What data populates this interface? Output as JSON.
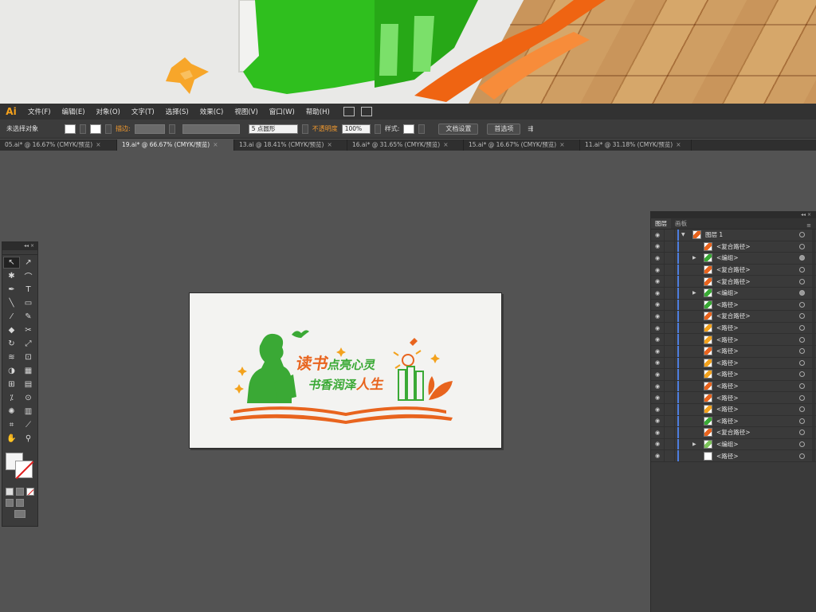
{
  "app": {
    "logo": "Ai"
  },
  "menu": [
    "文件(F)",
    "编辑(E)",
    "对象(O)",
    "文字(T)",
    "选择(S)",
    "效果(C)",
    "视图(V)",
    "窗口(W)",
    "帮助(H)"
  ],
  "control_bar": {
    "selection": "未选择对象",
    "stroke_label": "描边:",
    "brush": "5 点圆形",
    "opacity_label": "不透明度",
    "opacity_value": "100%",
    "style_label": "样式:",
    "doc_setup": "文档设置",
    "preferences": "首选项"
  },
  "tabs": [
    {
      "label": "05.ai* @ 16.67% (CMYK/预览)",
      "active": false
    },
    {
      "label": "19.ai* @ 66.67% (CMYK/预览)",
      "active": true
    },
    {
      "label": "13.ai @ 18.41% (CMYK/预览)",
      "active": false
    },
    {
      "label": "16.ai* @ 31.65% (CMYK/预览)",
      "active": false
    },
    {
      "label": "15.ai* @ 16.67% (CMYK/预览)",
      "active": false
    },
    {
      "label": "11.ai* @ 31.18% (CMYK/预览)",
      "active": false
    }
  ],
  "tab_close": "×",
  "artwork": {
    "title_big": "读书",
    "title_small": "点亮心灵",
    "subtitle": "书香润泽",
    "subtitle_end": "人生",
    "green": "#3aa935",
    "orange": "#e8641e"
  },
  "layers_panel": {
    "tab_layers": "图层",
    "tab_artboards": "画板",
    "collapse": "◂◂",
    "close": "×",
    "menu": "≡",
    "rows": [
      {
        "name": "图层 1",
        "indent": 0,
        "expand": "down",
        "thumb_color": "#e8641e",
        "target_filled": false
      },
      {
        "name": "<复合路径>",
        "indent": 1,
        "expand": "",
        "thumb_color": "#e8641e",
        "target_filled": false
      },
      {
        "name": "<编组>",
        "indent": 1,
        "expand": "right",
        "thumb_color": "#3aa935",
        "target_filled": true
      },
      {
        "name": "<复合路径>",
        "indent": 1,
        "expand": "",
        "thumb_color": "#e8641e",
        "target_filled": false
      },
      {
        "name": "<复合路径>",
        "indent": 1,
        "expand": "",
        "thumb_color": "#e8641e",
        "target_filled": false
      },
      {
        "name": "<编组>",
        "indent": 1,
        "expand": "right",
        "thumb_color": "#3aa935",
        "target_filled": true
      },
      {
        "name": "<路径>",
        "indent": 1,
        "expand": "",
        "thumb_color": "#3aa935",
        "target_filled": false
      },
      {
        "name": "<复合路径>",
        "indent": 1,
        "expand": "",
        "thumb_color": "#e8641e",
        "target_filled": false
      },
      {
        "name": "<路径>",
        "indent": 1,
        "expand": "",
        "thumb_color": "#f3a21d",
        "target_filled": false
      },
      {
        "name": "<路径>",
        "indent": 1,
        "expand": "",
        "thumb_color": "#f3a21d",
        "target_filled": false
      },
      {
        "name": "<路径>",
        "indent": 1,
        "expand": "",
        "thumb_color": "#e8641e",
        "target_filled": false
      },
      {
        "name": "<路径>",
        "indent": 1,
        "expand": "",
        "thumb_color": "#f3a21d",
        "target_filled": false
      },
      {
        "name": "<路径>",
        "indent": 1,
        "expand": "",
        "thumb_color": "#f3a21d",
        "target_filled": false
      },
      {
        "name": "<路径>",
        "indent": 1,
        "expand": "",
        "thumb_color": "#e8641e",
        "target_filled": false
      },
      {
        "name": "<路径>",
        "indent": 1,
        "expand": "",
        "thumb_color": "#e8641e",
        "target_filled": false
      },
      {
        "name": "<路径>",
        "indent": 1,
        "expand": "",
        "thumb_color": "#f3a21d",
        "target_filled": false
      },
      {
        "name": "<路径>",
        "indent": 1,
        "expand": "",
        "thumb_color": "#3aa935",
        "target_filled": false
      },
      {
        "name": "<复合路径>",
        "indent": 1,
        "expand": "",
        "thumb_color": "#e8641e",
        "target_filled": false
      },
      {
        "name": "<编组>",
        "indent": 1,
        "expand": "right",
        "thumb_color": "#7cc35a",
        "target_filled": false
      },
      {
        "name": "<路径>",
        "indent": 1,
        "expand": "",
        "thumb_color": "#ffffff",
        "target_filled": false
      }
    ]
  },
  "tools_panel": {
    "header": "◂◂ ×"
  }
}
